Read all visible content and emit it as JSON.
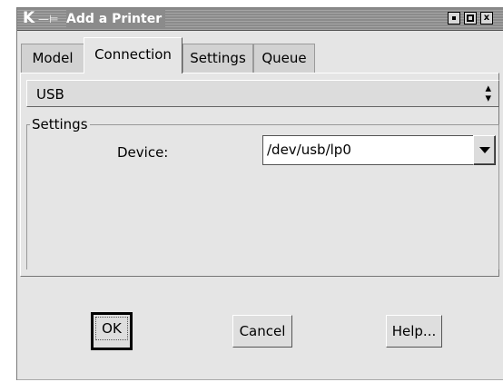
{
  "window": {
    "title": "Add a Printer",
    "app_icon": "k-icon",
    "pin_icon": "pin-icon",
    "controls": [
      "minimize-icon",
      "maximize-icon",
      "close-icon"
    ],
    "close_glyph": "x"
  },
  "tabs": [
    {
      "label": "Model",
      "active": false
    },
    {
      "label": "Connection",
      "active": true
    },
    {
      "label": "Settings",
      "active": false
    },
    {
      "label": "Queue",
      "active": false
    }
  ],
  "connection_type": {
    "selected": "USB"
  },
  "settings_group": {
    "title": "Settings",
    "device_label": "Device:",
    "device_value": "/dev/usb/lp0"
  },
  "buttons": {
    "ok": "OK",
    "cancel": "Cancel",
    "help": "Help..."
  }
}
